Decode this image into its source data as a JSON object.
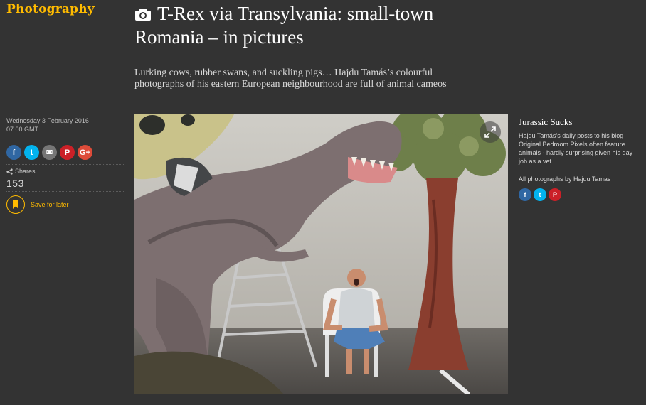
{
  "section": {
    "label": "Photography"
  },
  "article": {
    "headline": "T-Rex via Transylvania: small-town Romania – in pictures",
    "standfirst": "Lurking cows, rubber swans, and suckling pigs… Hajdu Tamás’s colourful photographs of his eastern European neighbourhood are full of animal cameos"
  },
  "meta": {
    "date": "Wednesday 3 February 2016",
    "time": "07.00 GMT",
    "share_buttons": [
      {
        "icon": "facebook-icon",
        "glyph": "f",
        "color": "#3067a3"
      },
      {
        "icon": "twitter-icon",
        "glyph": "t",
        "color": "#03b3ee"
      },
      {
        "icon": "email-icon",
        "glyph": "✉",
        "color": "#767676"
      },
      {
        "icon": "pinterest-icon",
        "glyph": "P",
        "color": "#cb2027"
      },
      {
        "icon": "google-plus-icon",
        "glyph": "G+",
        "color": "#dd4b39"
      }
    ],
    "shares_label": "Shares",
    "shares_count": "153",
    "save_label": "Save for later"
  },
  "caption": {
    "title": "Jurassic Sucks",
    "text": "Hajdu Tamás’s daily posts to his blog Original Bedroom Pixels often feature animals - hardly surprising given his day job as a vet.",
    "credit": "All photographs by Hajdu Tamas",
    "share_buttons": [
      {
        "icon": "facebook-icon",
        "glyph": "f",
        "color": "#3067a3"
      },
      {
        "icon": "twitter-icon",
        "glyph": "t",
        "color": "#03b3ee"
      },
      {
        "icon": "pinterest-icon",
        "glyph": "P",
        "color": "#cb2027"
      }
    ]
  },
  "colors": {
    "accent": "#ffbb00",
    "background": "#333333"
  }
}
